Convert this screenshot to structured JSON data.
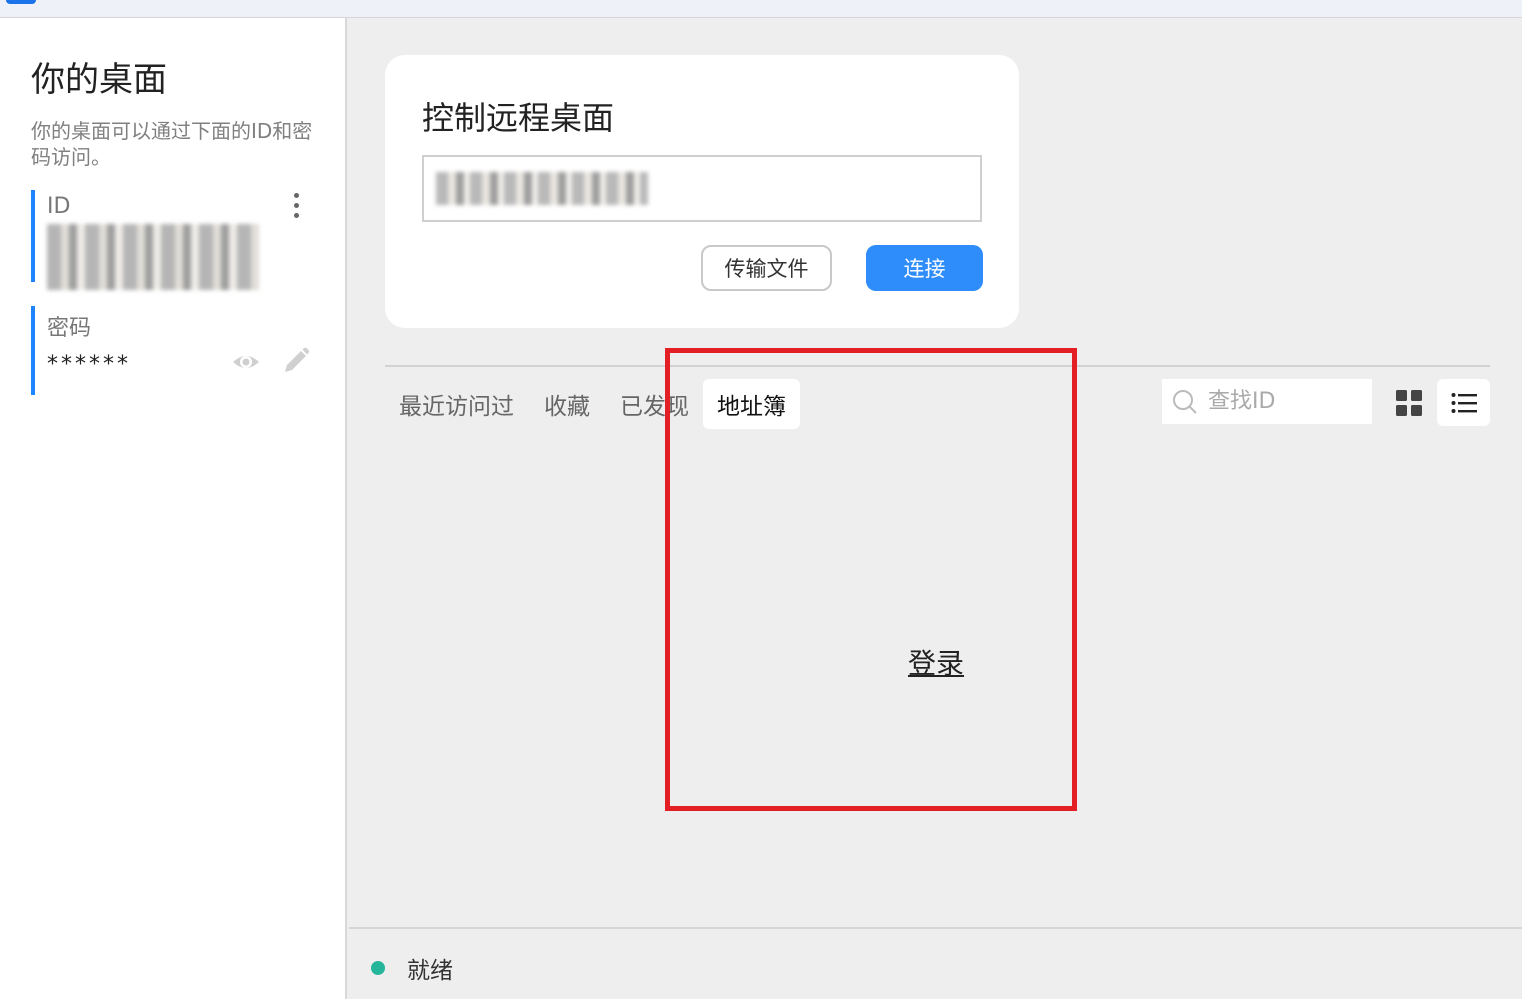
{
  "sidebar": {
    "title": "你的桌面",
    "description": "你的桌面可以通过下面的ID和密码访问。",
    "id_label": "ID",
    "id_value": "███ ███ ███",
    "password_label": "密码",
    "password_value": "******"
  },
  "connect_card": {
    "title": "控制远程桌面",
    "id_input_value": "███ ███ ███",
    "transfer_button": "传输文件",
    "connect_button": "连接"
  },
  "tabs": [
    {
      "label": "最近访问过"
    },
    {
      "label": "收藏"
    },
    {
      "label": "已发现"
    },
    {
      "label": "地址簿",
      "active": true
    }
  ],
  "search": {
    "placeholder": "查找ID"
  },
  "address_book": {
    "login_link": "登录"
  },
  "status": {
    "text": "就绪",
    "color": "#25b59a"
  },
  "colors": {
    "accent": "#2e8cfb",
    "highlight": "#e31e24"
  },
  "icons": [
    "kebab-menu-icon",
    "eye-icon",
    "pencil-icon",
    "search-icon",
    "grid-view-icon",
    "list-view-icon"
  ]
}
